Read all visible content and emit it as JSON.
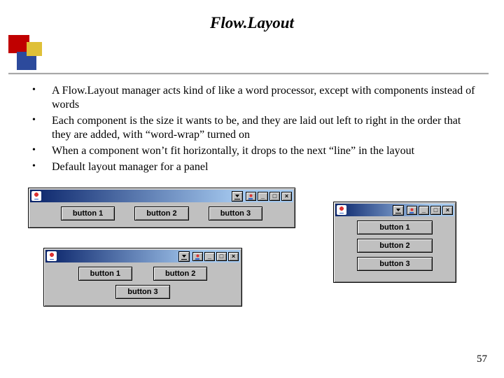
{
  "title": "Flow.Layout",
  "page_number": "57",
  "bullets": [
    "A Flow.Layout manager acts kind of like a word processor, except with components instead of words",
    "Each component is the size it wants to be, and they are laid out left to right in the order that they are added, with “word-wrap” turned on",
    "When a component won’t fit horizontally, it drops to the next “line” in the layout",
    "Default layout manager for a panel"
  ],
  "window_controls": {
    "minimize_glyph": "_",
    "maximize_glyph": "□",
    "close_glyph": "×"
  },
  "examples": {
    "wide": {
      "buttons": [
        "button 1",
        "button 2",
        "button 3"
      ]
    },
    "medium": {
      "row1": [
        "button 1",
        "button 2"
      ],
      "row2": [
        "button 3"
      ]
    },
    "narrow": {
      "buttons": [
        "button 1",
        "button 2",
        "button 3"
      ]
    }
  }
}
